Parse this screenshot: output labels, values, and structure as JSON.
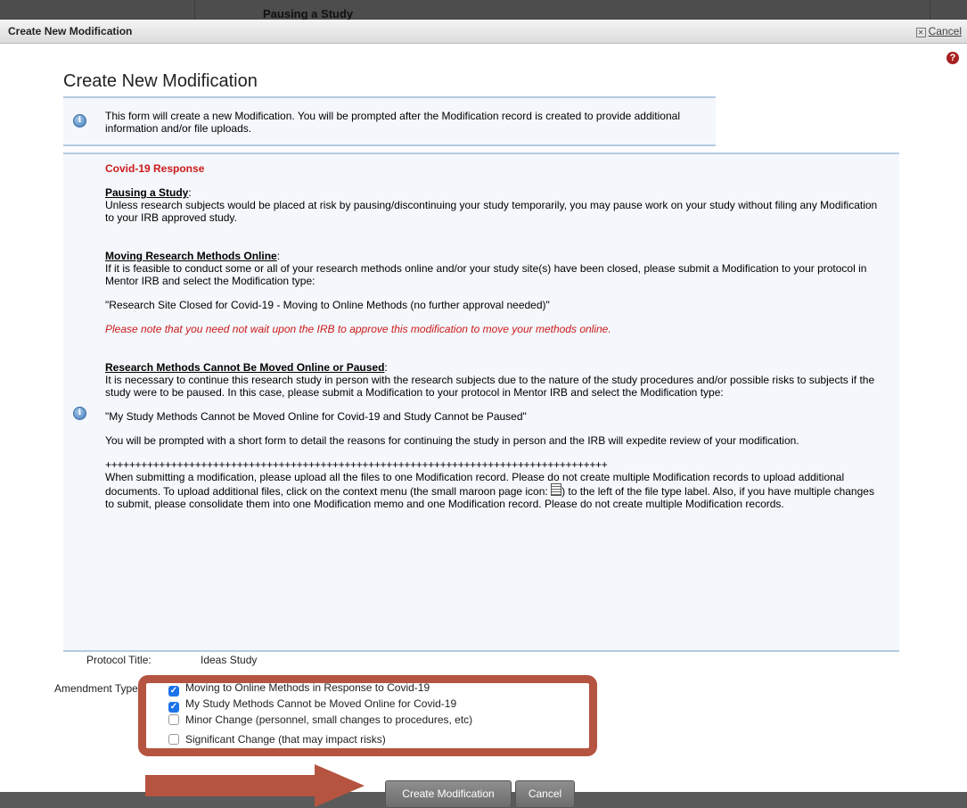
{
  "background": {
    "title": "Pausing a Study"
  },
  "dialog": {
    "title": "Create New Modification",
    "cancel_label": "Cancel",
    "heading": "Create New Modification",
    "info_text": "This form will create a new Modification. You will be prompted after the Modification record is created to provide additional information and/or file uploads."
  },
  "covid": {
    "title": "Covid-19 Response",
    "pause_heading": "Pausing a Study",
    "pause_text": "Unless research subjects would be placed at risk by pausing/discontinuing your study temporarily, you may pause work on your study without filing any Modification to your IRB approved study.",
    "online_heading": "Moving Research Methods Online",
    "online_text": "If it is feasible to conduct some or all of your research methods online and/or your study site(s) have been closed, please submit a Modification to your protocol in Mentor IRB and select the Modification type:",
    "online_type": "\"Research Site Closed for Covid-19 - Moving to Online Methods (no further approval needed)\"",
    "online_note": "Please note that you need not wait upon the IRB to approve this modification to move your methods online.",
    "cannot_heading": "Research Methods Cannot Be Moved Online or Paused",
    "cannot_text": "It is necessary to continue this research study in person with the research subjects due to the nature of the study procedures and/or possible risks to subjects if the study were to be paused. In this case, please submit a Modification to your protocol in Mentor IRB and select the Modification type:",
    "cannot_type": "\"My Study Methods Cannot be Moved Online for Covid-19 and Study Cannot be Paused\"",
    "cannot_followup": "You will be prompted with a short form to detail the reasons for continuing the study in person and the IRB will expedite review of your modification.",
    "separator": "++++++++++++++++++++++++++++++++++++++++++++++++++++++++++++++++++++++++++++++++++++",
    "upload_text_1": "When submitting a modification, please upload all the files to one Modification record. Please do not create multiple Modification records to upload additional documents. To upload additional files, click on the context menu (the small maroon page icon:",
    "upload_text_2": ") to the left of the file type label. Also, if you have multiple changes to submit, please consolidate them into one Modification memo and one Modification record. Please do not create multiple Modification records."
  },
  "form": {
    "protocol_label": "Protocol Title:",
    "protocol_value": "Ideas Study",
    "amendment_label": "Amendment Type:",
    "options": [
      {
        "label": "Moving to Online Methods in Response to Covid-19",
        "checked": true
      },
      {
        "label": "My Study Methods Cannot be Moved Online for Covid-19",
        "checked": true
      },
      {
        "label": "Minor Change (personnel, small changes to procedures, etc)",
        "checked": false
      },
      {
        "label": "Significant Change (that may impact risks)",
        "checked": false
      }
    ]
  },
  "buttons": {
    "create": "Create Modification",
    "cancel": "Cancel"
  },
  "colors": {
    "annotation": "#b55440",
    "accent_red": "#cc1a1a",
    "checkbox": "#1a73e8"
  }
}
